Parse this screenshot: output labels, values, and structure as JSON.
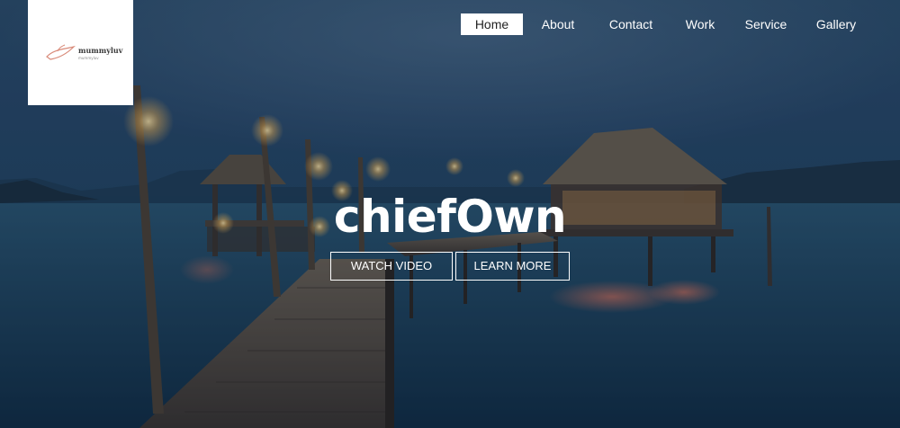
{
  "logo": {
    "name": "mummyluv",
    "tagline": "mummyluv"
  },
  "nav": {
    "items": [
      {
        "label": "Home",
        "active": true
      },
      {
        "label": "About",
        "active": false
      },
      {
        "label": "Contact",
        "active": false
      },
      {
        "label": "Work",
        "active": false
      },
      {
        "label": "Service",
        "active": false
      },
      {
        "label": "Gallery",
        "active": false
      }
    ]
  },
  "hero": {
    "headline": "chiefOwn",
    "buttons": {
      "watch": "WATCH VIDEO",
      "learn": "LEARN MORE"
    },
    "background": "tropical-pier-at-dusk"
  },
  "colors": {
    "overlay": "#1b3a55",
    "nav_active_bg": "#ffffff",
    "text": "#ffffff"
  }
}
